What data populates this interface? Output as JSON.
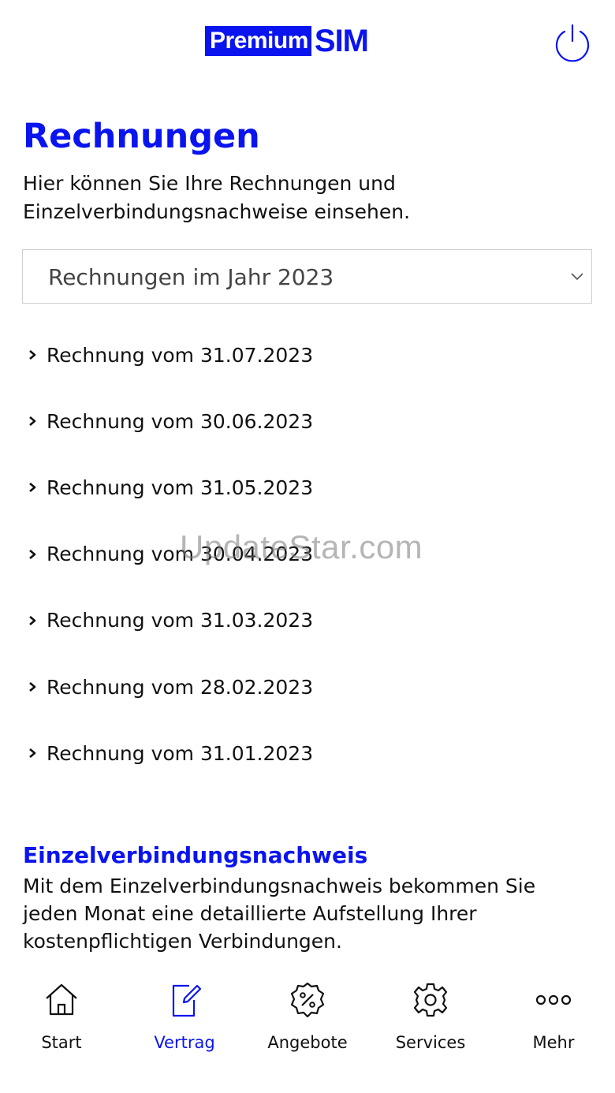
{
  "header": {
    "logo_left": "Premium",
    "logo_right": "SIM",
    "power_icon": "power-icon"
  },
  "page": {
    "title": "Rechnungen",
    "intro": "Hier können Sie Ihre Rechnungen und Einzelverbindungsnachweise einsehen."
  },
  "year_select": {
    "value": "Rechnungen im Jahr 2023",
    "icon": "chevron-down-icon"
  },
  "invoices": [
    "Rechnung vom 31.07.2023",
    "Rechnung vom 30.06.2023",
    "Rechnung vom 31.05.2023",
    "Rechnung vom 30.04.2023",
    "Rechnung vom 31.03.2023",
    "Rechnung vom 28.02.2023",
    "Rechnung vom 31.01.2023"
  ],
  "watermark": "UpdateStar.com",
  "evn": {
    "title": "Einzelverbindungsnachweis",
    "text": "Mit dem Einzelverbindungsnachweis bekommen Sie jeden Monat eine detaillierte Aufstellung Ihrer kostenpflichtigen Verbindungen."
  },
  "nav": [
    {
      "label": "Start",
      "icon": "home-icon"
    },
    {
      "label": "Vertrag",
      "icon": "contract-edit-icon",
      "active": true
    },
    {
      "label": "Angebote",
      "icon": "percent-badge-icon"
    },
    {
      "label": "Services",
      "icon": "gear-icon"
    },
    {
      "label": "Mehr",
      "icon": "more-dots-icon"
    }
  ],
  "colors": {
    "brand_blue": "#0a14ef",
    "text": "#111111",
    "border": "#cfcfcf"
  }
}
